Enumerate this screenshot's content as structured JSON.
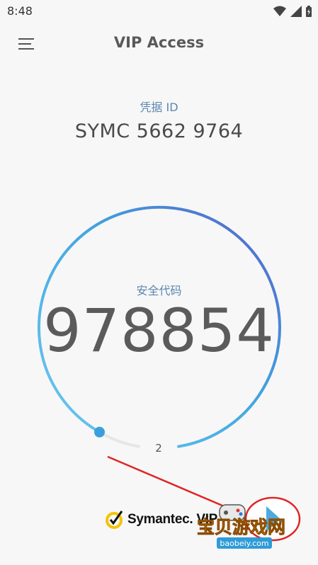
{
  "status_bar": {
    "time": "8:48",
    "icons": [
      "wifi-icon",
      "signal-icon",
      "battery-icon"
    ]
  },
  "header": {
    "menu_icon": "hamburger-menu-icon",
    "title": "VIP Access"
  },
  "credential": {
    "label": "凭据 ID",
    "value": "SYMC 5662 9764"
  },
  "security_code": {
    "label": "安全代码",
    "value": "978854",
    "seconds_remaining": "2"
  },
  "brand": {
    "name": "Symantec. VIP",
    "logo_icon": "symantec-check-icon"
  },
  "watermark": {
    "text": "宝贝游戏网",
    "url": "baobeiy.com"
  },
  "colors": {
    "ring_start": "#6dc8ee",
    "ring_end": "#5560c8",
    "label_blue": "#5b86b0",
    "annotation_red": "#e02525"
  }
}
